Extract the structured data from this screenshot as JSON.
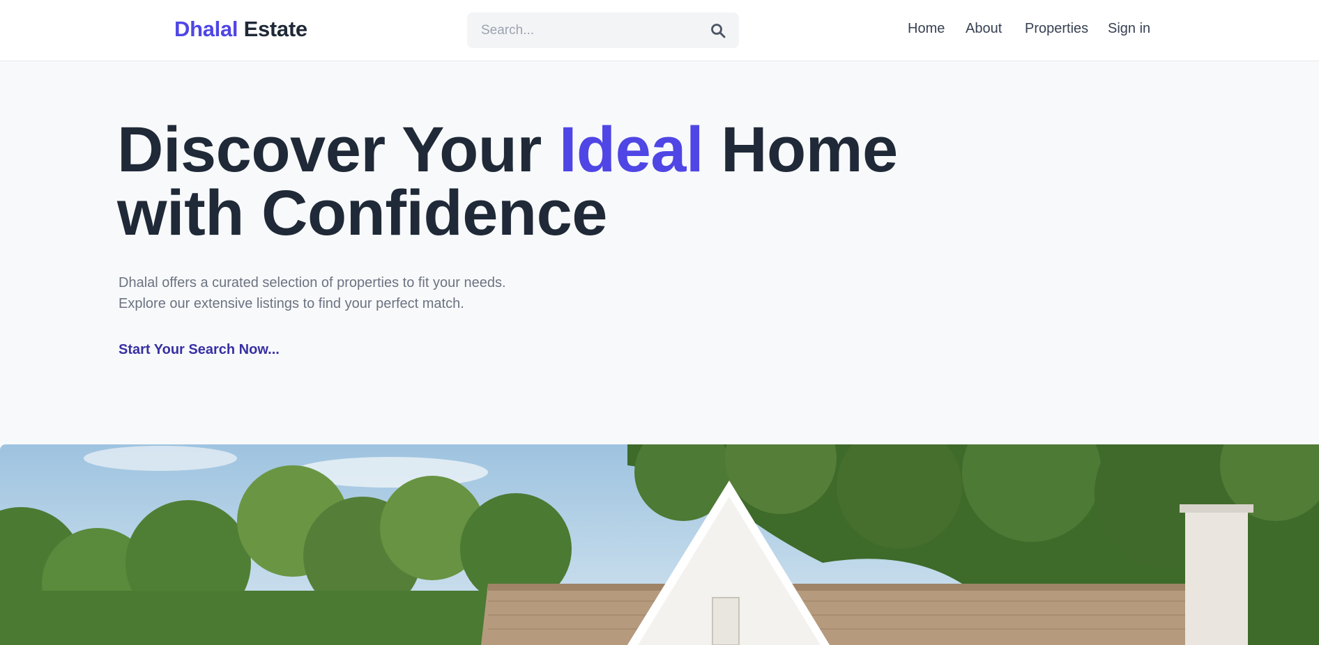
{
  "header": {
    "logo": {
      "accent": "Dhalal",
      "main": "Estate"
    },
    "search": {
      "placeholder": "Search...",
      "value": "",
      "icon": "search-icon"
    },
    "nav": [
      {
        "label": "Home"
      },
      {
        "label": "About"
      },
      {
        "label": "Properties"
      },
      {
        "label": "Sign in"
      }
    ]
  },
  "hero": {
    "title_part1": "Discover Your ",
    "title_highlight": "Ideal",
    "title_part2": " Home",
    "title_line2": "with Confidence",
    "description_line1": "Dhalal offers a curated selection of properties to fit your needs.",
    "description_line2": "Explore our extensive listings to find your perfect match.",
    "cta_label": "Start Your Search Now..."
  },
  "colors": {
    "accent": "#4f46e5",
    "heading": "#1f2937",
    "muted_text": "#6b7280",
    "cta": "#3730a3",
    "page_bg": "#f8f9fb",
    "header_bg": "#ffffff"
  }
}
